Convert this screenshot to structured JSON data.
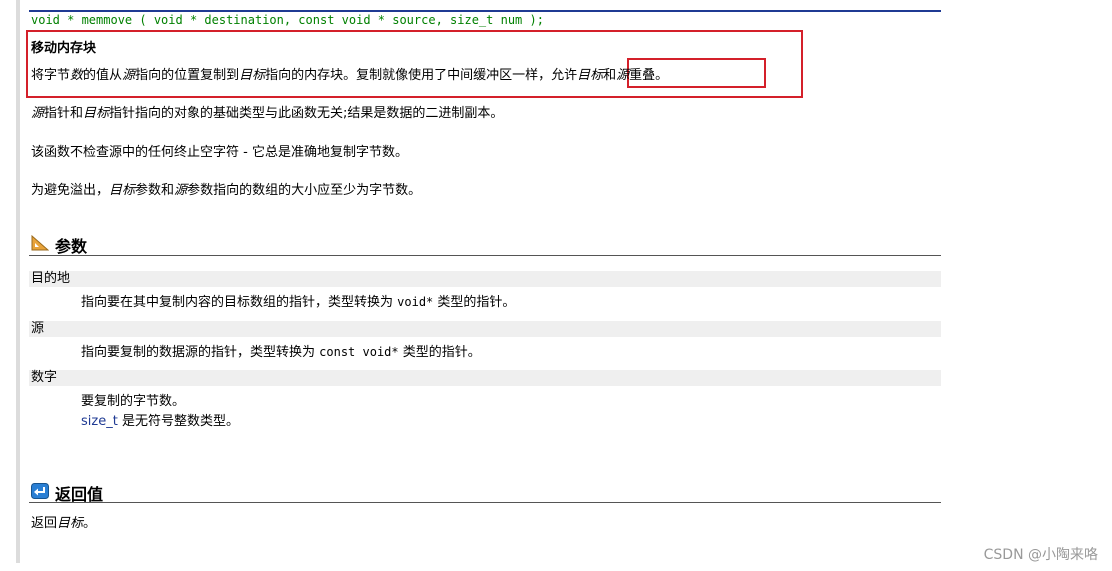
{
  "signature": "void * memmove ( void * destination, const void * source, size_t num );",
  "summary_title": "移动内存块",
  "description": {
    "p1_a": "将字节",
    "p1_num": "数",
    "p1_b": "的值从",
    "p1_source": "源",
    "p1_c": "指向的位置复制到",
    "p1_dest": "目标",
    "p1_d": "指向的内存块。复制就像使用了中间缓冲区一样，",
    "p1_e": "允许",
    "p1_dest2": "目标",
    "p1_f": "和",
    "p1_source2": "源",
    "p1_g": "重叠。",
    "p2_source": "源",
    "p2_a": "指针和",
    "p2_dest": "目标",
    "p2_b": "指针指向的对象的基础类型与此函数无关;结果是数据的二进制副本。",
    "p3": "该函数不检查源中的任何终止空字符 - 它总是准确地复制字节数。",
    "p4_a": "为避免溢出，",
    "p4_dest": "目标",
    "p4_b": "参数和",
    "p4_source": "源",
    "p4_c": "参数指向的数组的大小应至少为字节数。"
  },
  "params_section": {
    "title": "参数",
    "items": [
      {
        "name": "目的地",
        "desc_a": "指向要在其中复制内容的目标数组的指针，类型转换为 ",
        "desc_code": "void*",
        "desc_b": " 类型的指针。"
      },
      {
        "name": "源",
        "desc_a": "指向要复制的数据源的指针，类型转换为 ",
        "desc_code": "const void*",
        "desc_b": " 类型的指针。"
      },
      {
        "name": "数字",
        "desc_a": "要复制的字节数。",
        "extra_type": "size_t",
        "extra_text": " 是无符号整数类型。"
      }
    ]
  },
  "return_section": {
    "title": "返回值",
    "text_a": "返回",
    "text_dest": "目标",
    "text_b": "。"
  },
  "watermark": "CSDN @小陶来咯",
  "colors": {
    "signature_text": "#008000",
    "highlight_border": "#d4202a",
    "rule_blue": "#1f3a93",
    "param_row_bg": "#efefef"
  },
  "icons": [
    "ruler-triangle-icon",
    "return-arrow-icon"
  ]
}
